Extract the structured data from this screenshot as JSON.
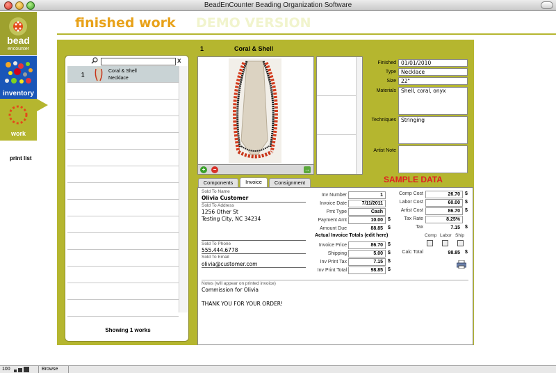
{
  "window": {
    "title": "BeadEnCounter Beading Organization Software"
  },
  "sidebar": {
    "logo_top": "bead",
    "logo_bottom": "encounter",
    "inventory_label": "inventory",
    "work_label": "work",
    "print_list": "print list"
  },
  "header": {
    "title": "finished work",
    "demo": "DEMO VERSION"
  },
  "list": {
    "rows": [
      {
        "num": "1",
        "name": "Coral & Shell",
        "type": "Necklace"
      }
    ],
    "showing": "Showing 1 works",
    "clear": "x"
  },
  "record": {
    "num": "1",
    "name": "Coral & Shell",
    "labels": {
      "finished": "Finished",
      "type": "Type",
      "size": "Size",
      "materials": "Materials",
      "techniques": "Techniques",
      "artist_note": "Artist Note"
    },
    "finished": "01/01/2010",
    "type": "Necklace",
    "size": "22\"",
    "materials": "Shell, coral, onyx",
    "techniques": "Stringing",
    "artist_note": ""
  },
  "sample_data": "SAMPLE DATA",
  "tabs": [
    "Components",
    "Invoice",
    "Consignment"
  ],
  "invoice": {
    "labels": {
      "sold_to_name": "Sold To Name",
      "sold_to_address": "Sold To Address",
      "sold_to_phone": "Sold To Phone",
      "sold_to_email": "Sold To Email",
      "notes": "Notes (will appear on printed invoice)"
    },
    "sold_to_name": "Olivia Customer",
    "address_line1": "1256 Other St",
    "address_line2": "Testing City, NC 34234",
    "phone": "555.444.6778",
    "email": "olivia@customer.com",
    "notes_line1": "Commission for Olivia",
    "notes_line2": "THANK YOU FOR YOUR ORDER!",
    "mid_labels": {
      "inv_number": "Inv Number",
      "invoice_date": "Invoice Date",
      "pmt_type": "Pmt Type",
      "payment_amt": "Payment Amt",
      "amount_due": "Amount Due",
      "totals_header": "Actual Invoice Totals (edit here)",
      "invoice_price": "Invoice Price",
      "shipping": "Shipping",
      "inv_print_tax": "Inv Print Tax",
      "inv_print_total": "Inv Print Total"
    },
    "inv_number": "1",
    "invoice_date": "7/11/2011",
    "pmt_type": "Cash",
    "payment_amt": "10.00",
    "amount_due": "88.85",
    "invoice_price": "86.70",
    "shipping": "5.00",
    "inv_print_tax": "7.15",
    "inv_print_total": "98.85",
    "currency": "$",
    "right_labels": {
      "comp_cost": "Comp Cost",
      "labor_cost": "Labor Cost",
      "artist_cost": "Artist Cost",
      "tax_rate": "Tax Rate",
      "tax": "Tax",
      "calc_total": "Calc Total"
    },
    "comp_cost": "26.70",
    "labor_cost": "60.00",
    "artist_cost": "86.70",
    "tax_rate": "8.25%",
    "tax": "7.15",
    "calc_total": "98.85",
    "check_labels": [
      "Comp",
      "Labor",
      "Ship"
    ]
  },
  "status": {
    "zoom": "100",
    "mode": "Browse"
  },
  "colors": {
    "olive": "#b5b62f",
    "orange_title": "#e8a21a",
    "inventory_blue": "#1a56b8",
    "sample_red": "#e02020"
  }
}
